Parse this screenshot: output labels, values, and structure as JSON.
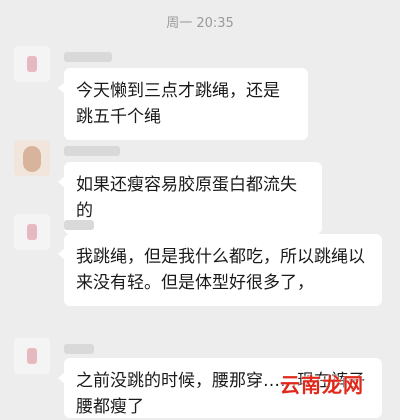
{
  "header": {
    "timestamp": "周一 20:35"
  },
  "messages": [
    {
      "text": "今天懒到三点才跳绳，还是跳五千个绳"
    },
    {
      "text": "如果还瘦容易胶原蛋白都流失的"
    },
    {
      "text": "我跳绳，但是我什么都吃，所以跳绳以来没有轻。但是体型好很多了，"
    },
    {
      "text": "之前没跳的时候，腰那穿……现在裤子腰都瘦了"
    }
  ],
  "watermark": {
    "text": "云南龙网"
  },
  "colors": {
    "background": "#ededed",
    "bubble": "#ffffff",
    "watermark": "#e0291b"
  }
}
